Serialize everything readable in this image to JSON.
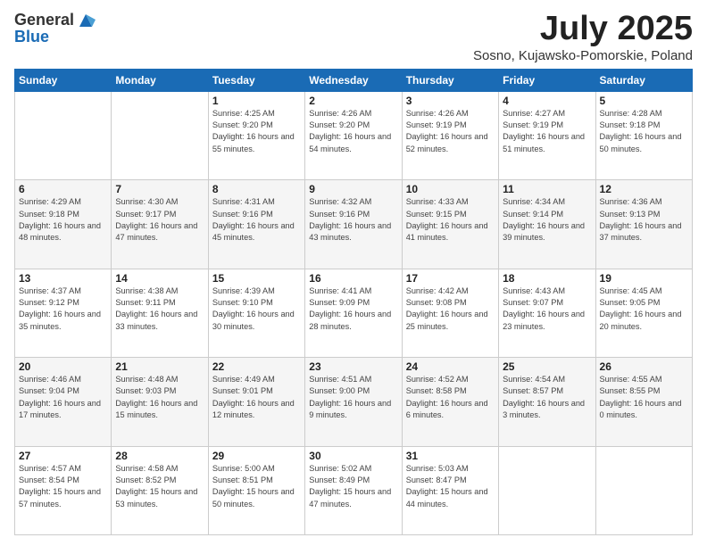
{
  "header": {
    "logo_general": "General",
    "logo_blue": "Blue",
    "month": "July 2025",
    "location": "Sosno, Kujawsko-Pomorskie, Poland"
  },
  "days_of_week": [
    "Sunday",
    "Monday",
    "Tuesday",
    "Wednesday",
    "Thursday",
    "Friday",
    "Saturday"
  ],
  "weeks": [
    [
      {
        "day": "",
        "sunrise": "",
        "sunset": "",
        "daylight": ""
      },
      {
        "day": "",
        "sunrise": "",
        "sunset": "",
        "daylight": ""
      },
      {
        "day": "1",
        "sunrise": "Sunrise: 4:25 AM",
        "sunset": "Sunset: 9:20 PM",
        "daylight": "Daylight: 16 hours and 55 minutes."
      },
      {
        "day": "2",
        "sunrise": "Sunrise: 4:26 AM",
        "sunset": "Sunset: 9:20 PM",
        "daylight": "Daylight: 16 hours and 54 minutes."
      },
      {
        "day": "3",
        "sunrise": "Sunrise: 4:26 AM",
        "sunset": "Sunset: 9:19 PM",
        "daylight": "Daylight: 16 hours and 52 minutes."
      },
      {
        "day": "4",
        "sunrise": "Sunrise: 4:27 AM",
        "sunset": "Sunset: 9:19 PM",
        "daylight": "Daylight: 16 hours and 51 minutes."
      },
      {
        "day": "5",
        "sunrise": "Sunrise: 4:28 AM",
        "sunset": "Sunset: 9:18 PM",
        "daylight": "Daylight: 16 hours and 50 minutes."
      }
    ],
    [
      {
        "day": "6",
        "sunrise": "Sunrise: 4:29 AM",
        "sunset": "Sunset: 9:18 PM",
        "daylight": "Daylight: 16 hours and 48 minutes."
      },
      {
        "day": "7",
        "sunrise": "Sunrise: 4:30 AM",
        "sunset": "Sunset: 9:17 PM",
        "daylight": "Daylight: 16 hours and 47 minutes."
      },
      {
        "day": "8",
        "sunrise": "Sunrise: 4:31 AM",
        "sunset": "Sunset: 9:16 PM",
        "daylight": "Daylight: 16 hours and 45 minutes."
      },
      {
        "day": "9",
        "sunrise": "Sunrise: 4:32 AM",
        "sunset": "Sunset: 9:16 PM",
        "daylight": "Daylight: 16 hours and 43 minutes."
      },
      {
        "day": "10",
        "sunrise": "Sunrise: 4:33 AM",
        "sunset": "Sunset: 9:15 PM",
        "daylight": "Daylight: 16 hours and 41 minutes."
      },
      {
        "day": "11",
        "sunrise": "Sunrise: 4:34 AM",
        "sunset": "Sunset: 9:14 PM",
        "daylight": "Daylight: 16 hours and 39 minutes."
      },
      {
        "day": "12",
        "sunrise": "Sunrise: 4:36 AM",
        "sunset": "Sunset: 9:13 PM",
        "daylight": "Daylight: 16 hours and 37 minutes."
      }
    ],
    [
      {
        "day": "13",
        "sunrise": "Sunrise: 4:37 AM",
        "sunset": "Sunset: 9:12 PM",
        "daylight": "Daylight: 16 hours and 35 minutes."
      },
      {
        "day": "14",
        "sunrise": "Sunrise: 4:38 AM",
        "sunset": "Sunset: 9:11 PM",
        "daylight": "Daylight: 16 hours and 33 minutes."
      },
      {
        "day": "15",
        "sunrise": "Sunrise: 4:39 AM",
        "sunset": "Sunset: 9:10 PM",
        "daylight": "Daylight: 16 hours and 30 minutes."
      },
      {
        "day": "16",
        "sunrise": "Sunrise: 4:41 AM",
        "sunset": "Sunset: 9:09 PM",
        "daylight": "Daylight: 16 hours and 28 minutes."
      },
      {
        "day": "17",
        "sunrise": "Sunrise: 4:42 AM",
        "sunset": "Sunset: 9:08 PM",
        "daylight": "Daylight: 16 hours and 25 minutes."
      },
      {
        "day": "18",
        "sunrise": "Sunrise: 4:43 AM",
        "sunset": "Sunset: 9:07 PM",
        "daylight": "Daylight: 16 hours and 23 minutes."
      },
      {
        "day": "19",
        "sunrise": "Sunrise: 4:45 AM",
        "sunset": "Sunset: 9:05 PM",
        "daylight": "Daylight: 16 hours and 20 minutes."
      }
    ],
    [
      {
        "day": "20",
        "sunrise": "Sunrise: 4:46 AM",
        "sunset": "Sunset: 9:04 PM",
        "daylight": "Daylight: 16 hours and 17 minutes."
      },
      {
        "day": "21",
        "sunrise": "Sunrise: 4:48 AM",
        "sunset": "Sunset: 9:03 PM",
        "daylight": "Daylight: 16 hours and 15 minutes."
      },
      {
        "day": "22",
        "sunrise": "Sunrise: 4:49 AM",
        "sunset": "Sunset: 9:01 PM",
        "daylight": "Daylight: 16 hours and 12 minutes."
      },
      {
        "day": "23",
        "sunrise": "Sunrise: 4:51 AM",
        "sunset": "Sunset: 9:00 PM",
        "daylight": "Daylight: 16 hours and 9 minutes."
      },
      {
        "day": "24",
        "sunrise": "Sunrise: 4:52 AM",
        "sunset": "Sunset: 8:58 PM",
        "daylight": "Daylight: 16 hours and 6 minutes."
      },
      {
        "day": "25",
        "sunrise": "Sunrise: 4:54 AM",
        "sunset": "Sunset: 8:57 PM",
        "daylight": "Daylight: 16 hours and 3 minutes."
      },
      {
        "day": "26",
        "sunrise": "Sunrise: 4:55 AM",
        "sunset": "Sunset: 8:55 PM",
        "daylight": "Daylight: 16 hours and 0 minutes."
      }
    ],
    [
      {
        "day": "27",
        "sunrise": "Sunrise: 4:57 AM",
        "sunset": "Sunset: 8:54 PM",
        "daylight": "Daylight: 15 hours and 57 minutes."
      },
      {
        "day": "28",
        "sunrise": "Sunrise: 4:58 AM",
        "sunset": "Sunset: 8:52 PM",
        "daylight": "Daylight: 15 hours and 53 minutes."
      },
      {
        "day": "29",
        "sunrise": "Sunrise: 5:00 AM",
        "sunset": "Sunset: 8:51 PM",
        "daylight": "Daylight: 15 hours and 50 minutes."
      },
      {
        "day": "30",
        "sunrise": "Sunrise: 5:02 AM",
        "sunset": "Sunset: 8:49 PM",
        "daylight": "Daylight: 15 hours and 47 minutes."
      },
      {
        "day": "31",
        "sunrise": "Sunrise: 5:03 AM",
        "sunset": "Sunset: 8:47 PM",
        "daylight": "Daylight: 15 hours and 44 minutes."
      },
      {
        "day": "",
        "sunrise": "",
        "sunset": "",
        "daylight": ""
      },
      {
        "day": "",
        "sunrise": "",
        "sunset": "",
        "daylight": ""
      }
    ]
  ]
}
